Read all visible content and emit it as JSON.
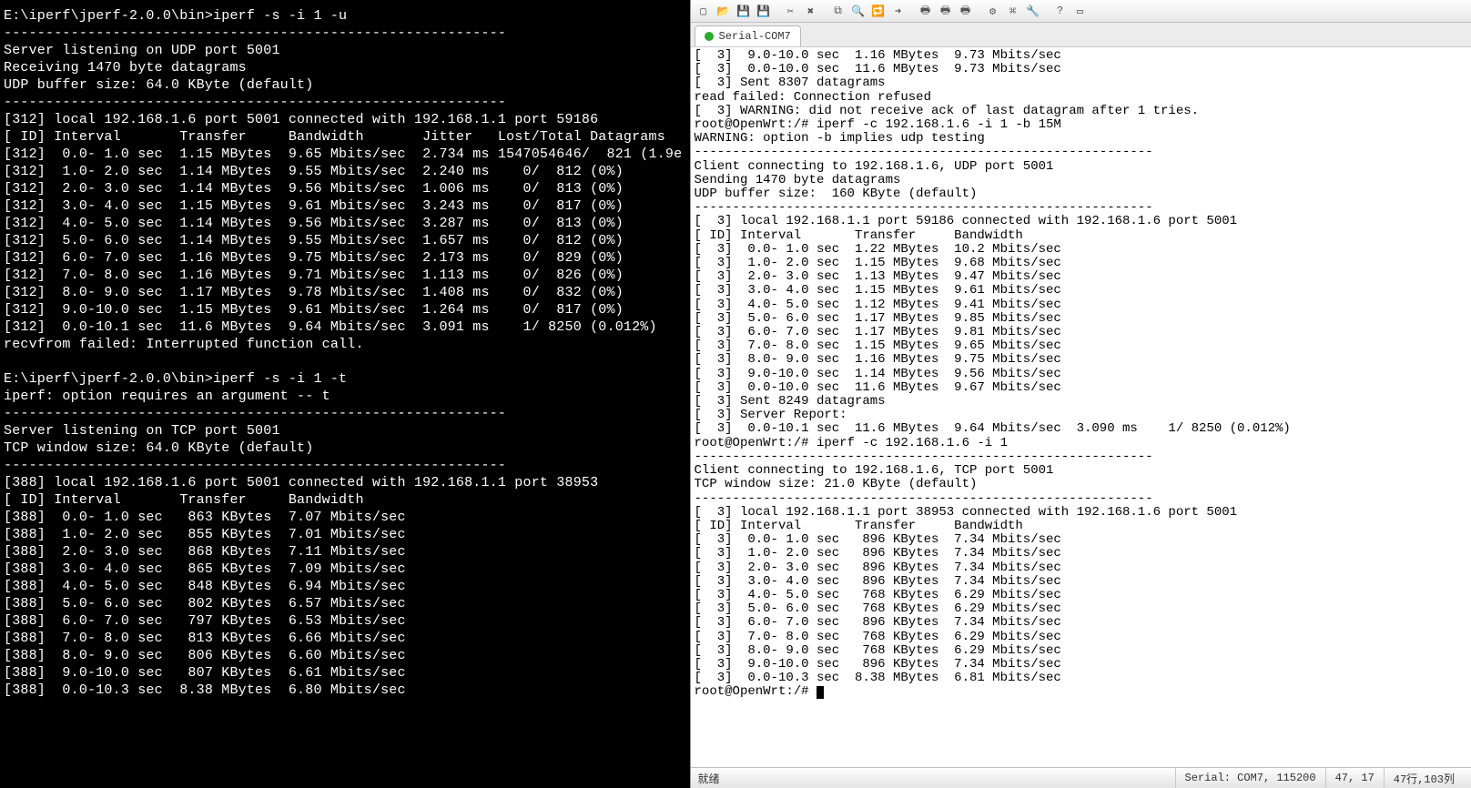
{
  "left_terminal": {
    "prompt1": "E:\\iperf\\jperf-2.0.0\\bin>iperf -s -i 1 -u",
    "hr": "------------------------------------------------------------",
    "udp_header": [
      "Server listening on UDP port 5001",
      "Receiving 1470 byte datagrams",
      "UDP buffer size: 64.0 KByte (default)"
    ],
    "udp_conn": "[312] local 192.168.1.6 port 5001 connected with 192.168.1.1 port 59186",
    "udp_cols": "[ ID] Interval       Transfer     Bandwidth       Jitter   Lost/Total Datagrams",
    "udp_rows": [
      "[312]  0.0- 1.0 sec  1.15 MBytes  9.65 Mbits/sec  2.734 ms 1547054646/  821 (1.9e",
      "[312]  1.0- 2.0 sec  1.14 MBytes  9.55 Mbits/sec  2.240 ms    0/  812 (0%)",
      "[312]  2.0- 3.0 sec  1.14 MBytes  9.56 Mbits/sec  1.006 ms    0/  813 (0%)",
      "[312]  3.0- 4.0 sec  1.15 MBytes  9.61 Mbits/sec  3.243 ms    0/  817 (0%)",
      "[312]  4.0- 5.0 sec  1.14 MBytes  9.56 Mbits/sec  3.287 ms    0/  813 (0%)",
      "[312]  5.0- 6.0 sec  1.14 MBytes  9.55 Mbits/sec  1.657 ms    0/  812 (0%)",
      "[312]  6.0- 7.0 sec  1.16 MBytes  9.75 Mbits/sec  2.173 ms    0/  829 (0%)",
      "[312]  7.0- 8.0 sec  1.16 MBytes  9.71 Mbits/sec  1.113 ms    0/  826 (0%)",
      "[312]  8.0- 9.0 sec  1.17 MBytes  9.78 Mbits/sec  1.408 ms    0/  832 (0%)",
      "[312]  9.0-10.0 sec  1.15 MBytes  9.61 Mbits/sec  1.264 ms    0/  817 (0%)",
      "[312]  0.0-10.1 sec  11.6 MBytes  9.64 Mbits/sec  3.091 ms    1/ 8250 (0.012%)"
    ],
    "udp_tail": "recvfrom failed: Interrupted function call.",
    "prompt2": "E:\\iperf\\jperf-2.0.0\\bin>iperf -s -i 1 -t",
    "err2": "iperf: option requires an argument -- t",
    "tcp_header": [
      "Server listening on TCP port 5001",
      "TCP window size: 64.0 KByte (default)"
    ],
    "tcp_conn": "[388] local 192.168.1.6 port 5001 connected with 192.168.1.1 port 38953",
    "tcp_cols": "[ ID] Interval       Transfer     Bandwidth",
    "tcp_rows": [
      "[388]  0.0- 1.0 sec   863 KBytes  7.07 Mbits/sec",
      "[388]  1.0- 2.0 sec   855 KBytes  7.01 Mbits/sec",
      "[388]  2.0- 3.0 sec   868 KBytes  7.11 Mbits/sec",
      "[388]  3.0- 4.0 sec   865 KBytes  7.09 Mbits/sec",
      "[388]  4.0- 5.0 sec   848 KBytes  6.94 Mbits/sec",
      "[388]  5.0- 6.0 sec   802 KBytes  6.57 Mbits/sec",
      "[388]  6.0- 7.0 sec   797 KBytes  6.53 Mbits/sec",
      "[388]  7.0- 8.0 sec   813 KBytes  6.66 Mbits/sec",
      "[388]  8.0- 9.0 sec   806 KBytes  6.60 Mbits/sec",
      "[388]  9.0-10.0 sec   807 KBytes  6.61 Mbits/sec",
      "[388]  0.0-10.3 sec  8.38 MBytes  6.80 Mbits/sec"
    ]
  },
  "right_app": {
    "toolbar_icons": [
      "new-icon",
      "open-icon",
      "save-icon",
      "saveall-icon",
      "cut-icon",
      "delete-icon",
      "copy-icon",
      "find-icon",
      "replace-icon",
      "goto-icon",
      "print-icon",
      "printpreview-icon",
      "printsetup-icon",
      "settings-icon",
      "macro-icon",
      "tools-icon",
      "help-icon",
      "window-icon"
    ],
    "tab_label": "Serial-COM7",
    "lines": [
      "[  3]  9.0-10.0 sec  1.16 MBytes  9.73 Mbits/sec",
      "[  3]  0.0-10.0 sec  11.6 MBytes  9.73 Mbits/sec",
      "[  3] Sent 8307 datagrams",
      "read failed: Connection refused",
      "[  3] WARNING: did not receive ack of last datagram after 1 tries.",
      "root@OpenWrt:/# iperf -c 192.168.1.6 -i 1 -b 15M",
      "WARNING: option -b implies udp testing",
      "------------------------------------------------------------",
      "Client connecting to 192.168.1.6, UDP port 5001",
      "Sending 1470 byte datagrams",
      "UDP buffer size:  160 KByte (default)",
      "------------------------------------------------------------",
      "[  3] local 192.168.1.1 port 59186 connected with 192.168.1.6 port 5001",
      "[ ID] Interval       Transfer     Bandwidth",
      "[  3]  0.0- 1.0 sec  1.22 MBytes  10.2 Mbits/sec",
      "[  3]  1.0- 2.0 sec  1.15 MBytes  9.68 Mbits/sec",
      "[  3]  2.0- 3.0 sec  1.13 MBytes  9.47 Mbits/sec",
      "[  3]  3.0- 4.0 sec  1.15 MBytes  9.61 Mbits/sec",
      "[  3]  4.0- 5.0 sec  1.12 MBytes  9.41 Mbits/sec",
      "[  3]  5.0- 6.0 sec  1.17 MBytes  9.85 Mbits/sec",
      "[  3]  6.0- 7.0 sec  1.17 MBytes  9.81 Mbits/sec",
      "[  3]  7.0- 8.0 sec  1.15 MBytes  9.65 Mbits/sec",
      "[  3]  8.0- 9.0 sec  1.16 MBytes  9.75 Mbits/sec",
      "[  3]  9.0-10.0 sec  1.14 MBytes  9.56 Mbits/sec",
      "[  3]  0.0-10.0 sec  11.6 MBytes  9.67 Mbits/sec",
      "[  3] Sent 8249 datagrams",
      "[  3] Server Report:",
      "[  3]  0.0-10.1 sec  11.6 MBytes  9.64 Mbits/sec  3.090 ms    1/ 8250 (0.012%)",
      "root@OpenWrt:/# iperf -c 192.168.1.6 -i 1",
      "------------------------------------------------------------",
      "Client connecting to 192.168.1.6, TCP port 5001",
      "TCP window size: 21.0 KByte (default)",
      "------------------------------------------------------------",
      "[  3] local 192.168.1.1 port 38953 connected with 192.168.1.6 port 5001",
      "[ ID] Interval       Transfer     Bandwidth",
      "[  3]  0.0- 1.0 sec   896 KBytes  7.34 Mbits/sec",
      "[  3]  1.0- 2.0 sec   896 KBytes  7.34 Mbits/sec",
      "[  3]  2.0- 3.0 sec   896 KBytes  7.34 Mbits/sec",
      "[  3]  3.0- 4.0 sec   896 KBytes  7.34 Mbits/sec",
      "[  3]  4.0- 5.0 sec   768 KBytes  6.29 Mbits/sec",
      "[  3]  5.0- 6.0 sec   768 KBytes  6.29 Mbits/sec",
      "[  3]  6.0- 7.0 sec   896 KBytes  7.34 Mbits/sec",
      "[  3]  7.0- 8.0 sec   768 KBytes  6.29 Mbits/sec",
      "[  3]  8.0- 9.0 sec   768 KBytes  6.29 Mbits/sec",
      "[  3]  9.0-10.0 sec   896 KBytes  7.34 Mbits/sec",
      "[  3]  0.0-10.3 sec  8.38 MBytes  6.81 Mbits/sec"
    ],
    "prompt_line": "root@OpenWrt:/# ",
    "status": {
      "ready": "就绪",
      "port": "Serial: COM7, 115200",
      "pos": "47, 17",
      "size": "47行,103列"
    }
  }
}
